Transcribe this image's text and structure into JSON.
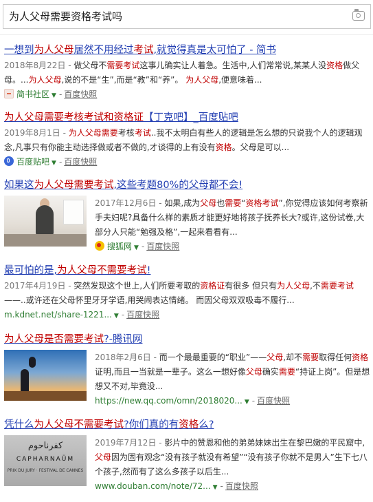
{
  "search": {
    "query": "为人父母需要资格考试吗",
    "camera_icon": "camera-icon"
  },
  "results": [
    {
      "title_parts": [
        {
          "t": "一想到",
          "em": false
        },
        {
          "t": "为人父母",
          "em": true
        },
        {
          "t": "居然不用经过",
          "em": false
        },
        {
          "t": "考试",
          "em": true
        },
        {
          "t": ",就觉得真是太可怕了 - 简书",
          "em": false
        }
      ],
      "abstract_parts": [
        {
          "t": "2018年8月22日 - ",
          "cls": "date"
        },
        {
          "t": "做父母不",
          "cls": ""
        },
        {
          "t": "需要考试",
          "cls": "em"
        },
        {
          "t": "这事儿确实让人着急。生活中,人们常常说,某某人没",
          "cls": ""
        },
        {
          "t": "资格",
          "cls": "em"
        },
        {
          "t": "做父母。...",
          "cls": ""
        },
        {
          "t": "为人父母",
          "cls": "em"
        },
        {
          "t": ",说的不是“生”,而是“教”和“养”。 ",
          "cls": ""
        },
        {
          "t": "为人父母",
          "cls": "em"
        },
        {
          "t": ",便意味着...",
          "cls": ""
        }
      ],
      "site": "简书社区",
      "site_icon": "jianshu-icon",
      "cache": "百度快照"
    },
    {
      "title_parts": [
        {
          "t": "为人父母需要考核考试和资格证",
          "em": true
        },
        {
          "t": "【丁克吧】_百度贴吧",
          "em": false
        }
      ],
      "abstract_parts": [
        {
          "t": "2019年8月1日 - ",
          "cls": "date"
        },
        {
          "t": "为人父母需要",
          "cls": "em"
        },
        {
          "t": "考核",
          "cls": ""
        },
        {
          "t": "考试",
          "cls": "em"
        },
        {
          "t": "..我不太明白有些人的逻辑是怎么想的只说我个人的逻辑观念,凡事只有你能主动选择做或者不做的,才谈得的上有没有",
          "cls": ""
        },
        {
          "t": "资格",
          "cls": "em"
        },
        {
          "t": "。父母是可以...",
          "cls": ""
        }
      ],
      "site": "百度贴吧",
      "site_icon": "tieba-icon",
      "cache": "百度快照"
    },
    {
      "title_parts": [
        {
          "t": "如果这",
          "em": false
        },
        {
          "t": "为人父母需要考试",
          "em": true
        },
        {
          "t": ",这些考题80%的父母都不会!",
          "em": false
        }
      ],
      "abstract_parts": [
        {
          "t": "2017年12月6日 - ",
          "cls": "date"
        },
        {
          "t": "如果,成为",
          "cls": ""
        },
        {
          "t": "父母",
          "cls": "em"
        },
        {
          "t": "也",
          "cls": ""
        },
        {
          "t": "需要",
          "cls": "em"
        },
        {
          "t": "“",
          "cls": ""
        },
        {
          "t": "资格考试",
          "cls": "em"
        },
        {
          "t": "”,你觉得应该如何考察新手夫妇呢?具备什么样的素质才能更好地将孩子抚养长大?或许,这份试卷,大部分人只能“勉强及格”,一起来看看有...",
          "cls": ""
        }
      ],
      "site": "搜狐网",
      "site_icon": "sohu-icon",
      "cache": "百度快照",
      "thumb": "office-photo"
    },
    {
      "title_parts": [
        {
          "t": "最可怕的是,",
          "em": false
        },
        {
          "t": "为人父母不需要考试",
          "em": true
        },
        {
          "t": "!",
          "em": false
        }
      ],
      "abstract_parts": [
        {
          "t": "2017年4月19日 - ",
          "cls": "date"
        },
        {
          "t": "突然发现这个世上,人们所要考取的",
          "cls": ""
        },
        {
          "t": "资格证",
          "cls": "em"
        },
        {
          "t": "有很多 但只有",
          "cls": ""
        },
        {
          "t": "为人父母",
          "cls": "em"
        },
        {
          "t": ",不",
          "cls": ""
        },
        {
          "t": "需要考试",
          "cls": "em"
        },
        {
          "t": "——..或许还在父母怀里牙牙学语,用哭闹表达情绪。 而因父母双双吸毒不履行...",
          "cls": ""
        }
      ],
      "url": "m.kdnet.net/share-1221...",
      "cache": "百度快照"
    },
    {
      "title_parts": [
        {
          "t": "为人父母是否需要考试",
          "em": true
        },
        {
          "t": "?-腾讯网",
          "em": false
        }
      ],
      "abstract_parts": [
        {
          "t": "2018年2月6日 - ",
          "cls": "date"
        },
        {
          "t": "而一个最最重要的“职业”——",
          "cls": ""
        },
        {
          "t": "父母",
          "cls": "em"
        },
        {
          "t": ",却不",
          "cls": ""
        },
        {
          "t": "需要",
          "cls": "em"
        },
        {
          "t": "取得任何",
          "cls": ""
        },
        {
          "t": "资格",
          "cls": "em"
        },
        {
          "t": "证明,而且一当就是一辈子。这么一想好像",
          "cls": ""
        },
        {
          "t": "父母",
          "cls": "em"
        },
        {
          "t": "确实",
          "cls": ""
        },
        {
          "t": "需要",
          "cls": "em"
        },
        {
          "t": "“持证上岗”。但是想想又不对,毕竟没...",
          "cls": ""
        }
      ],
      "url": "https://new.qq.com/omn/2018020...",
      "cache": "百度快照",
      "thumb": "sky-photo"
    },
    {
      "title_parts": [
        {
          "t": "凭什么",
          "em": false
        },
        {
          "t": "为人父母不需要考试",
          "em": true
        },
        {
          "t": "?你们真的有",
          "em": false
        },
        {
          "t": "资格",
          "em": true
        },
        {
          "t": "么?",
          "em": false
        }
      ],
      "abstract_parts": [
        {
          "t": "2019年7月12日 - ",
          "cls": "date"
        },
        {
          "t": "影片中的赞恩和他的弟弟妹妹出生在黎巴嫩的平民窟中,",
          "cls": ""
        },
        {
          "t": "父母",
          "cls": "em"
        },
        {
          "t": "因为固有观念“没有孩子就没有希望”“没有孩子你就不是男人”生下七八个孩子,然而有了这么多孩子以后生...",
          "cls": ""
        }
      ],
      "url": "www.douban.com/note/72...",
      "cache": "百度快照",
      "thumb": "movie-poster",
      "poster_text": [
        "كفرناحوم",
        "CAPHARNAÜM",
        "PRIX DU JURY · FESTIVAL DE CANNES"
      ]
    }
  ]
}
